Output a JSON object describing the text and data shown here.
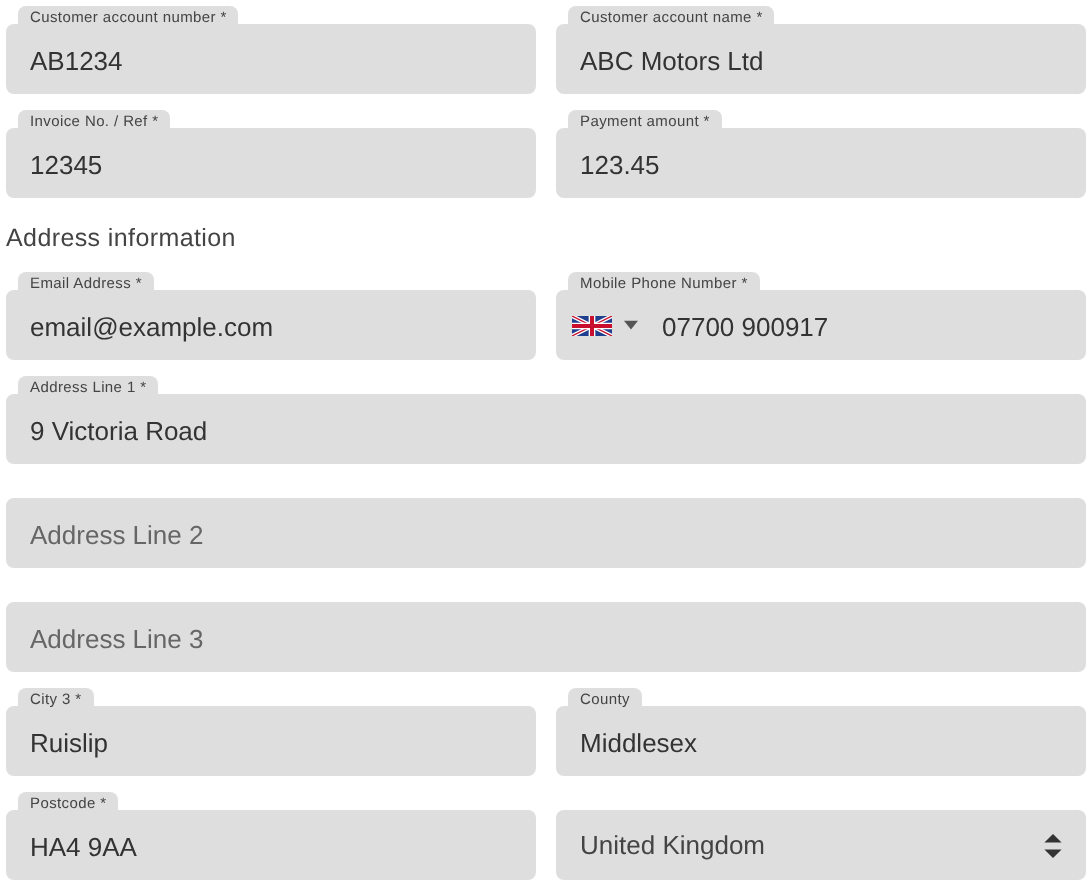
{
  "rows": [
    {
      "kind": "fields",
      "fields": [
        {
          "kind": "text",
          "label": "Customer account number *",
          "value": "AB1234"
        },
        {
          "kind": "text",
          "label": "Customer account name *",
          "value": "ABC Motors Ltd"
        }
      ]
    },
    {
      "kind": "fields",
      "fields": [
        {
          "kind": "text",
          "label": "Invoice No. / Ref *",
          "value": "12345"
        },
        {
          "kind": "text",
          "label": "Payment amount *",
          "value": "123.45"
        }
      ]
    },
    {
      "kind": "heading",
      "text": "Address information"
    },
    {
      "kind": "fields",
      "fields": [
        {
          "kind": "text",
          "label": "Email Address *",
          "value": "email@example.com"
        },
        {
          "kind": "phone",
          "label": "Mobile Phone Number *",
          "value": "07700 900917"
        }
      ]
    },
    {
      "kind": "fields",
      "fields": [
        {
          "kind": "text",
          "label": "Address Line 1 *",
          "value": "9 Victoria Road"
        }
      ]
    },
    {
      "kind": "fields",
      "fields": [
        {
          "kind": "text",
          "placeholder": "Address Line 2"
        }
      ]
    },
    {
      "kind": "fields",
      "fields": [
        {
          "kind": "text",
          "placeholder": "Address Line 3"
        }
      ]
    },
    {
      "kind": "fields",
      "fields": [
        {
          "kind": "text",
          "label": "City 3 *",
          "value": "Ruislip"
        },
        {
          "kind": "text",
          "label": "County",
          "value": "Middlesex"
        }
      ]
    },
    {
      "kind": "fields",
      "fields": [
        {
          "kind": "text",
          "label": "Postcode *",
          "value": "HA4 9AA"
        },
        {
          "kind": "select",
          "value": "United Kingdom"
        }
      ]
    }
  ]
}
